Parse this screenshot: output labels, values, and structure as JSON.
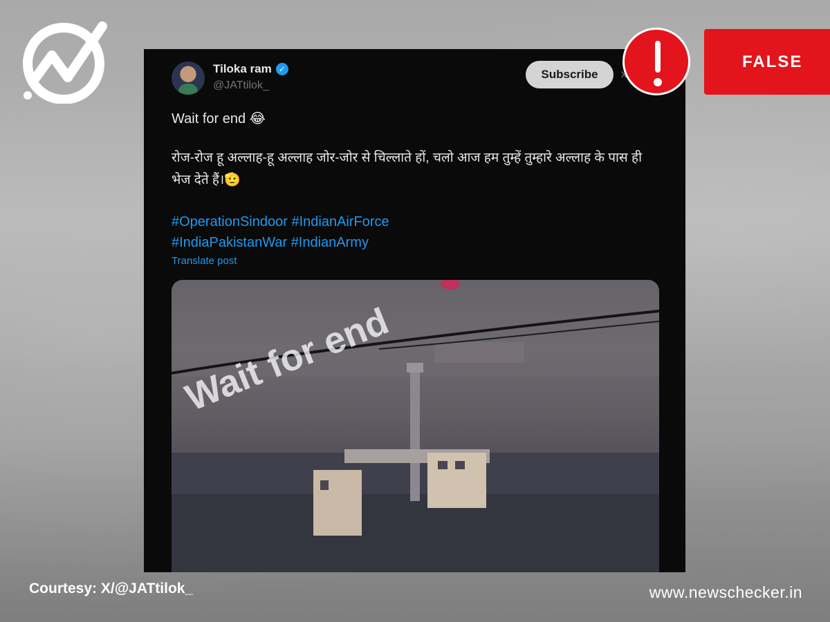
{
  "brand": {
    "logo_icon": "newschecker-logo-icon",
    "website": "www.newschecker.in"
  },
  "verdict": {
    "label": "FALSE",
    "icon": "exclamation-icon",
    "color": "#e3141b"
  },
  "credit": {
    "text": "Courtesy: X/@JATtilok_"
  },
  "tweet": {
    "author_name": "Tiloka ram",
    "handle": "@JATtilok_",
    "subscribe_label": "Subscribe",
    "text_line1": "Wait for end 😂",
    "text_line2": "रोज-रोज हू अल्लाह-हू अल्लाह जोर-जोर से चिल्लाते हों, चलो आज हम तुम्हें तुम्हारे अल्लाह के पास ही भेज देते हैं।🫡",
    "hashtags_line1": "#OperationSindoor #IndianAirForce",
    "hashtags_line2": "#IndiaPakistanWar #IndianArmy",
    "translate_label": "Translate post",
    "media_overlay_text": "Wait for end"
  },
  "colors": {
    "tweet_bg": "#0a0a0a",
    "link": "#1d9bf0",
    "text": "#e7e9ea",
    "muted": "#71767b"
  }
}
